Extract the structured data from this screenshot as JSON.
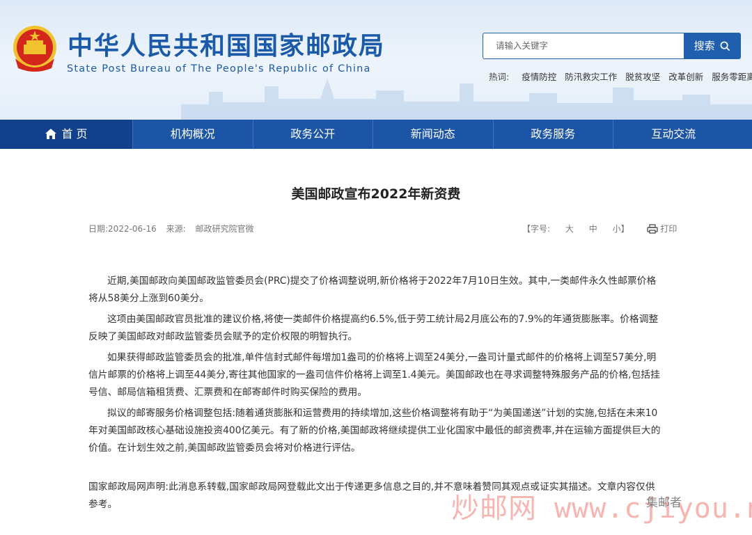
{
  "header": {
    "title": "中华人民共和国国家邮政局",
    "subtitle": "State Post Bureau of The People's Republic of China",
    "search_placeholder": "请输入关键字",
    "search_button": "搜索",
    "hot_label": "热词:",
    "hot_words": [
      "疫情防控",
      "防汛救灾工作",
      "脱贫攻坚",
      "改革创新",
      "服务零距离"
    ]
  },
  "nav": {
    "items": [
      "首 页",
      "机构概况",
      "政务公开",
      "新闻动态",
      "政务服务",
      "互动交流"
    ]
  },
  "article": {
    "title": "美国邮政宣布2022年新资费",
    "date_text": "日期:2022-06-16",
    "source_text": "来源:",
    "source_value": "邮政研究院官微",
    "font_size_label": "【字号:",
    "font_large": "大",
    "font_medium": "中",
    "font_small": "小】",
    "print_label": "打印",
    "paragraphs": [
      "近期,美国邮政向美国邮政监管委员会(PRC)提交了价格调整说明,新价格将于2022年7月10日生效。其中,一类邮件永久性邮票价格将从58美分上涨到60美分。",
      "这项由美国邮政官员批准的建议价格,将使一类邮件价格提高约6.5%,低于劳工统计局2月底公布的7.9%的年通货膨胀率。价格调整反映了美国邮政对邮政监管委员会赋予的定价权限的明智执行。",
      "如果获得邮政监管委员会的批准,单件信封式邮件每增加1盎司的价格将上调至24美分,一盎司计量式邮件的价格将上调至57美分,明信片邮票的价格将上调至44美分,寄往其他国家的一盎司信件价格将上调至1.4美元。美国邮政也在寻求调整特殊服务产品的价格,包括挂号信、邮局信箱租赁费、汇票费和在邮寄邮件时购买保险的费用。",
      "拟议的邮寄服务价格调整包括:随着通货膨胀和运营费用的持续增加,这些价格调整将有助于“为美国递送”计划的实施,包括在未来10年对美国邮政核心基础设施投资400亿美元。有了新的价格,美国邮政将继续提供工业化国家中最低的邮资费率,并在运输方面提供巨大的价值。在计划生效之前,美国邮政监管委员会将对价格进行评估。"
    ],
    "statement": "国家邮政局网声明:此消息系转载,国家邮政局网登载此文出于传递更多信息之目的,并不意味着赞同其观点或证实其描述。文章内容仅供参考。"
  },
  "watermark": {
    "text": "炒邮网 www.cjiyou.net",
    "badge": "集邮者"
  },
  "icons": {
    "emblem": "national-emblem-icon",
    "search": "search-icon",
    "home": "home-icon",
    "print": "print-icon"
  },
  "colors": {
    "brand_blue": "#1c55a6",
    "nav_active": "#12408a",
    "emblem_red": "#d4271c",
    "emblem_gold": "#f2c12e"
  }
}
